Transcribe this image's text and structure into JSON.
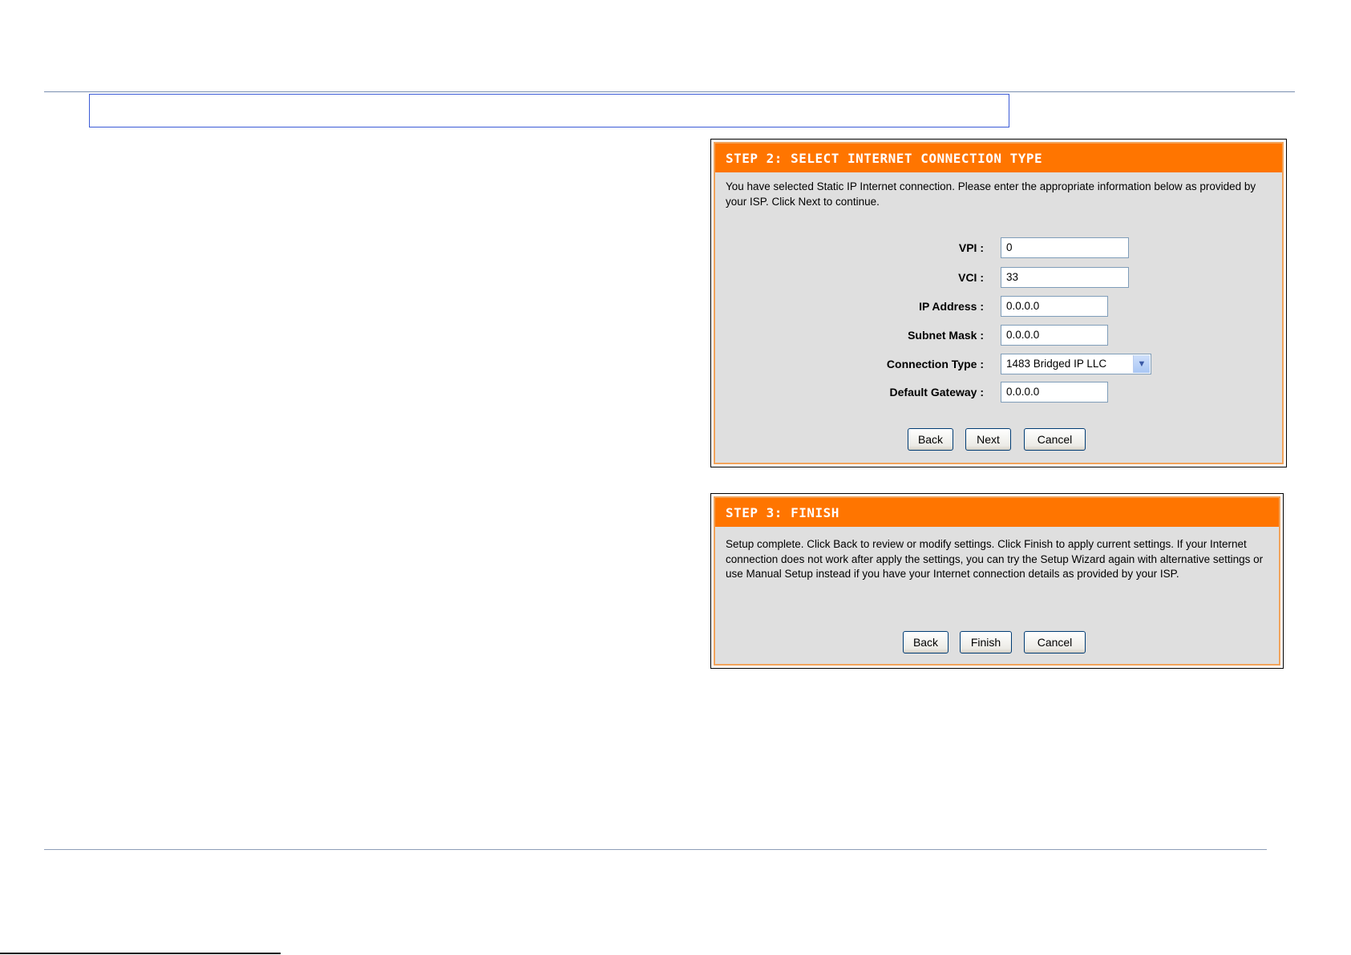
{
  "step2": {
    "title": "STEP 2: SELECT INTERNET CONNECTION TYPE",
    "description": "You have selected Static IP Internet connection. Please enter the appropriate information below as provided by your ISP. Click Next to continue.",
    "fields": {
      "vpi": {
        "label": "VPI :",
        "value": "0"
      },
      "vci": {
        "label": "VCI :",
        "value": "33"
      },
      "ip_address": {
        "label": "IP Address :",
        "value": "0.0.0.0"
      },
      "subnet_mask": {
        "label": "Subnet Mask :",
        "value": "0.0.0.0"
      },
      "connection_type": {
        "label": "Connection Type :",
        "value": "1483 Bridged IP LLC"
      },
      "default_gateway": {
        "label": "Default Gateway :",
        "value": "0.0.0.0"
      }
    },
    "buttons": {
      "back": "Back",
      "next": "Next",
      "cancel": "Cancel"
    }
  },
  "step3": {
    "title": "STEP 3: FINISH",
    "description": "Setup complete. Click Back to review or modify settings. Click Finish to apply current settings. If your Internet connection does not work after apply the settings, you can try the Setup Wizard again with alternative settings or use Manual Setup instead if you have your Internet connection details as provided by your ISP.",
    "buttons": {
      "back": "Back",
      "finish": "Finish",
      "cancel": "Cancel"
    }
  },
  "colors": {
    "title_bar": "#ff7500",
    "panel_bg": "#dfdfdf",
    "panel_border": "#f2a35a"
  },
  "icons": {
    "select_arrow": "chevron-down-icon"
  }
}
